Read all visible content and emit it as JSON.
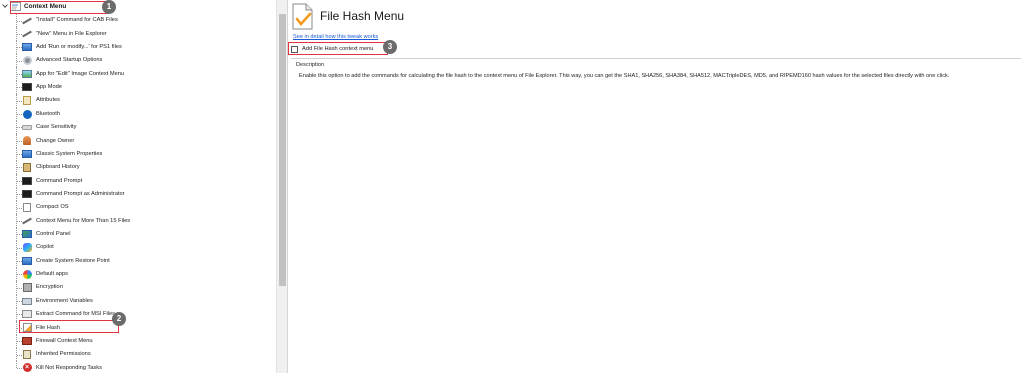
{
  "tree": {
    "root_label": "Context Menu",
    "items": [
      {
        "label": "\"Install\" Command for CAB Files",
        "icon": "wand-icon"
      },
      {
        "label": "\"New\" Menu in File Explorer",
        "icon": "wand-icon"
      },
      {
        "label": "Add 'Run or modify...' for PS1 files",
        "icon": "powershell-icon"
      },
      {
        "label": "Advanced Startup Options",
        "icon": "gear-icon"
      },
      {
        "label": "App for \"Edit\" Image Context Menu",
        "icon": "image-icon"
      },
      {
        "label": "App Mode",
        "icon": "console-icon"
      },
      {
        "label": "Attributes",
        "icon": "attributes-icon"
      },
      {
        "label": "Bluetooth",
        "icon": "bluetooth-icon"
      },
      {
        "label": "Case Sensitivity",
        "icon": "case-icon"
      },
      {
        "label": "Change Owner",
        "icon": "owner-icon"
      },
      {
        "label": "Classic System Properties",
        "icon": "system-icon"
      },
      {
        "label": "Clipboard History",
        "icon": "clipboard-icon"
      },
      {
        "label": "Command Prompt",
        "icon": "console-icon"
      },
      {
        "label": "Command Prompt as Administrator",
        "icon": "console-icon"
      },
      {
        "label": "Compact OS",
        "icon": "document-icon"
      },
      {
        "label": "Context Menu for More Than 15 Files",
        "icon": "wand-icon"
      },
      {
        "label": "Control Panel",
        "icon": "control-panel-icon"
      },
      {
        "label": "Copilot",
        "icon": "copilot-icon"
      },
      {
        "label": "Create System Restore Point",
        "icon": "restore-icon"
      },
      {
        "label": "Default apps",
        "icon": "apps-icon"
      },
      {
        "label": "Encryption",
        "icon": "encryption-icon"
      },
      {
        "label": "Environment Variables",
        "icon": "environment-icon"
      },
      {
        "label": "Extract Command for MSI Files",
        "icon": "msi-icon"
      },
      {
        "label": "File Hash",
        "icon": "file-hash-icon",
        "selected": true
      },
      {
        "label": "Firewall Context Menu",
        "icon": "firewall-icon"
      },
      {
        "label": "Inherited Permissions",
        "icon": "permissions-icon"
      },
      {
        "label": "Kill Not Responding Tasks",
        "icon": "kill-icon"
      }
    ]
  },
  "detail": {
    "title": "File Hash Menu",
    "how_link": "See in detail how this tweak works",
    "option_label": "Add File Hash context menu",
    "option_checked": false,
    "description_legend": "Description",
    "description_text": "Enable this option to add the commands for calculating the file hash to the context menu of File Explorer. This way, you can get the SHA1, SHA256, SHA384, SHA512, MACTripleDES, MD5, and RIPEMD160 hash values for the selected files directly with one click."
  },
  "annotations": {
    "badge_1": "1",
    "badge_2": "2",
    "badge_3": "3",
    "highlight_color": "#e0343f"
  }
}
